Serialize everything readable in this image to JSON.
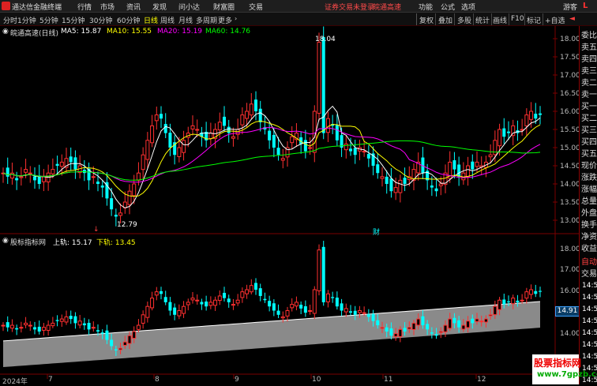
{
  "titlebar": {
    "app_name": "通达信金融终端",
    "menus": [
      "行情",
      "市场",
      "资讯",
      "发现",
      "问小达",
      "财富圈",
      "交易"
    ],
    "notice": "证券交易未登录",
    "stock": "皖通高速",
    "right_menus": [
      "功能",
      "公式",
      "选项",
      "游客"
    ],
    "badge": "L"
  },
  "periods": [
    "分时",
    "1分钟",
    "5分钟",
    "15分钟",
    "30分钟",
    "60分钟",
    "日线",
    "周线",
    "月线",
    "多周期",
    "更多"
  ],
  "active_period": "日线",
  "more_caret": "›",
  "tools": [
    "复权",
    "叠加",
    "多股",
    "统计",
    "画线",
    "F10",
    "标记",
    "+自选",
    "◄"
  ],
  "main_legend": {
    "stock_label": "皖通高速(日线)",
    "ma5": "MA5: 15.87",
    "ma10": "MA10: 15.55",
    "ma20": "MA20: 15.19",
    "ma60": "MA60: 14.76",
    "high_label": "18.04",
    "low_label": "12.79",
    "marker_cai": "财",
    "marker_down": "↓",
    "colors": {
      "ma5": "#ffffff",
      "ma10": "#ffff00",
      "ma20": "#ff00ff",
      "ma60": "#00ff00",
      "up": "#ff3030",
      "down": "#00ffff"
    }
  },
  "sub_legend": {
    "indicator_name": "股标指标网",
    "upper": "上轨: 15.17",
    "lower": "下轨: 13.45"
  },
  "axis_main": [
    "18.00",
    "17.50",
    "17.00",
    "16.50",
    "16.00",
    "15.50",
    "15.00",
    "14.50",
    "14.00",
    "13.50",
    "13.00"
  ],
  "axis_sub": [
    "18.00",
    "17.00",
    "16.00",
    "15.00",
    "14.00"
  ],
  "price_tag": "14.91",
  "dates": [
    "2024年",
    "7",
    "8",
    "9",
    "10",
    "11",
    "12"
  ],
  "right_panel": {
    "items": [
      "委比",
      "卖五",
      "卖四",
      "卖三",
      "卖二",
      "卖一",
      "买一",
      "买二",
      "买三",
      "买四",
      "买五",
      "现价",
      "涨跌",
      "涨幅",
      "总量",
      "外盘",
      "换手",
      "净资",
      "收益",
      "自动",
      "交易"
    ],
    "prices": [
      "14:50",
      "14:50",
      "14:50",
      "14:50",
      "14:50",
      "14:50",
      "14:50",
      "14:50",
      "14:50"
    ]
  },
  "watermark": {
    "line1": "股票指标网",
    "line2": "www.7gpzb.com"
  }
}
